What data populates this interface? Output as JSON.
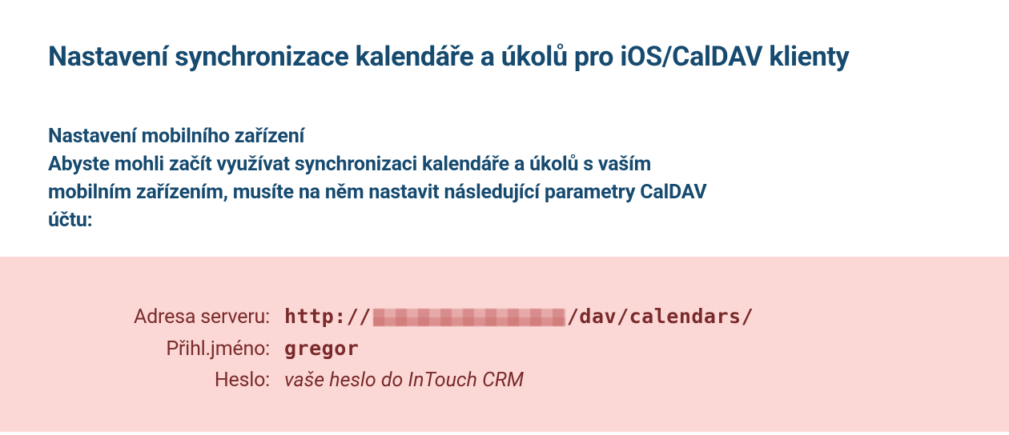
{
  "title": "Nastavení synchronizace kalendáře a úkolů pro iOS/CalDAV klienty",
  "intro": {
    "line1": "Nastavení mobilního zařízení",
    "line2": "Abyste mohli začít využívat synchronizaci kalendáře a úkolů s vaším mobilním zařízením, musíte na něm nastavit následující parametry CalDAV účtu:"
  },
  "params": {
    "server": {
      "label": "Adresa serveru:",
      "prefix": "http://",
      "suffix": "/dav/calendars/"
    },
    "login": {
      "label": "Přihl.jméno:",
      "value": "gregor"
    },
    "password": {
      "label": "Heslo:",
      "value": "vaše heslo do InTouch CRM"
    }
  }
}
